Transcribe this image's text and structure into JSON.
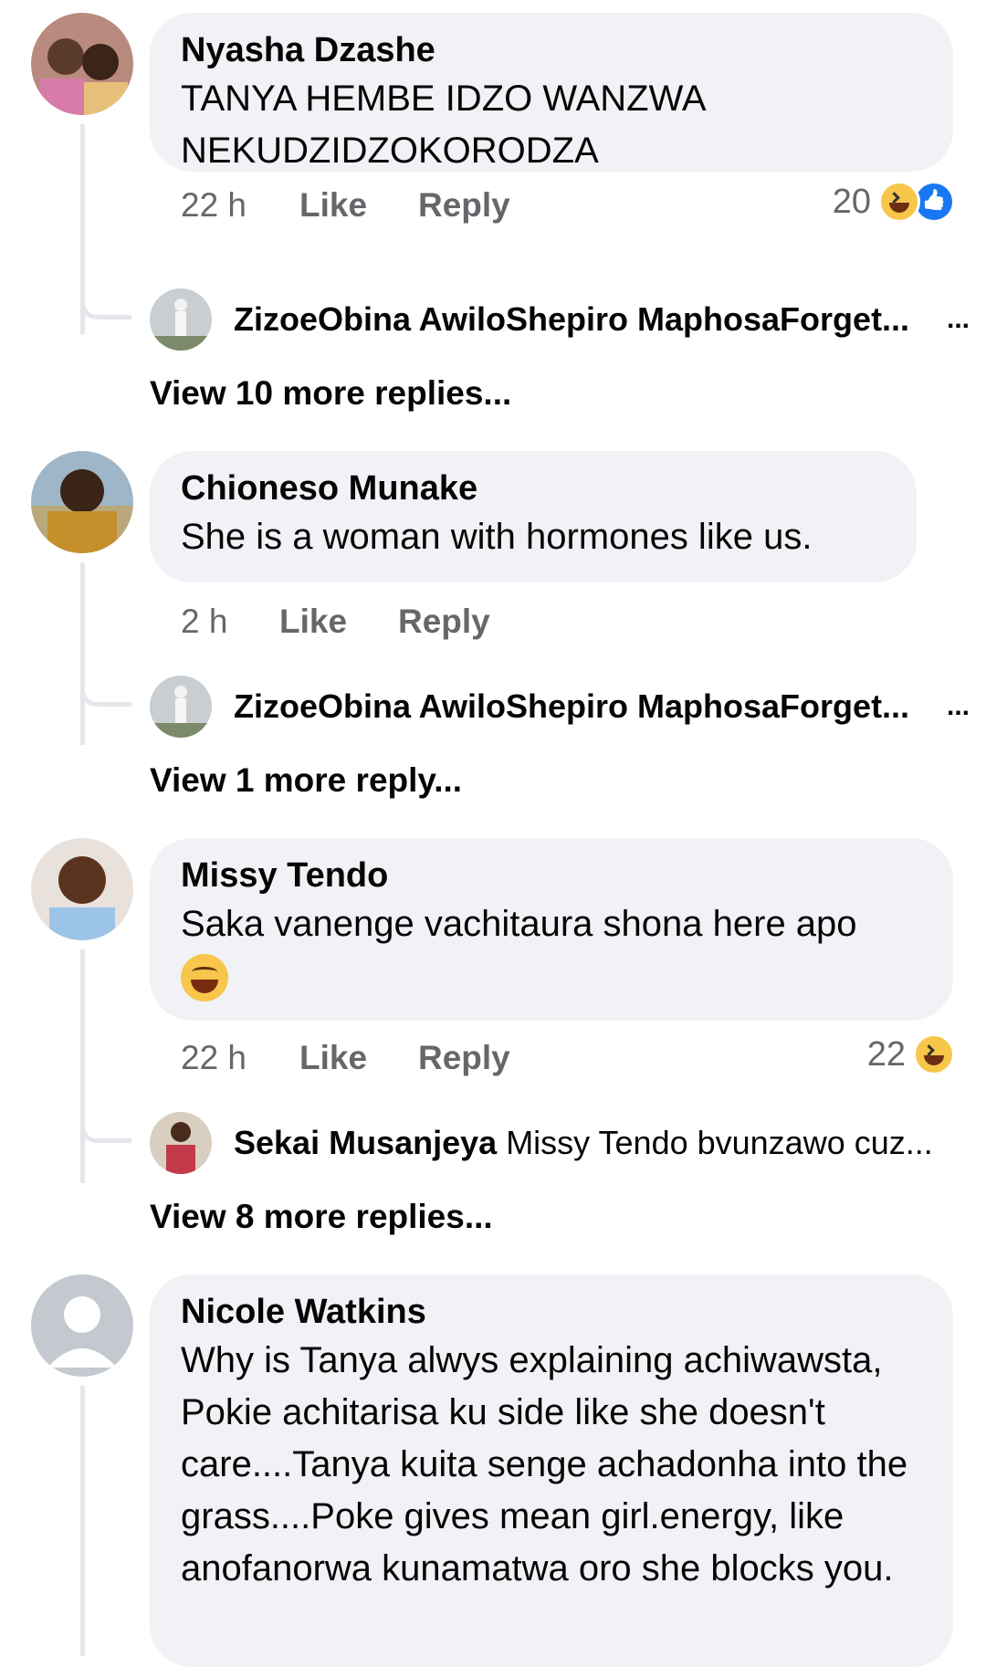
{
  "comments": [
    {
      "author": "Nyasha Dzashe",
      "text": "TANYA HEMBE IDZO WANZWA NEKUDZIDZOKORODZA",
      "time": "22 h",
      "like_label": "Like",
      "reply_label": "Reply",
      "reaction_count": "20",
      "reactions": [
        "haha-icon",
        "like-icon"
      ],
      "preview_reply": {
        "author": "ZizoeObina AwiloShepiro MaphosaForget...",
        "text": "",
        "more": "..."
      },
      "view_more": "View 10 more replies..."
    },
    {
      "author": "Chioneso Munake",
      "text": "She is a woman with hormones like us.",
      "time": "2 h",
      "like_label": "Like",
      "reply_label": "Reply",
      "preview_reply": {
        "author": "ZizoeObina AwiloShepiro MaphosaForget...",
        "text": "",
        "more": "..."
      },
      "view_more": "View 1 more reply..."
    },
    {
      "author": "Missy Tendo",
      "text": "Saka vanenge vachitaura shona here apo",
      "time": "22 h",
      "like_label": "Like",
      "reply_label": "Reply",
      "reaction_count": "22",
      "reactions": [
        "haha-icon"
      ],
      "preview_reply": {
        "author": "Sekai Musanjeya",
        "text": "Missy Tendo bvunzawo cuz...",
        "more": ""
      },
      "view_more": "View 8 more replies..."
    },
    {
      "author": "Nicole Watkins",
      "text": "Why is Tanya alwys explaining achiwawsta, Pokie achitarisa ku side like she doesn't care....Tanya kuita senge achadonha into the grass....Poke gives mean girl.energy, like anofanorwa kunamatwa oro she blocks you."
    }
  ],
  "colors": {
    "bubble": "#f0f2f5",
    "meta": "#65676b",
    "thread_line": "#e4e6eb",
    "like_blue": "#1877f2",
    "haha_yellow": "#f7c64a"
  }
}
